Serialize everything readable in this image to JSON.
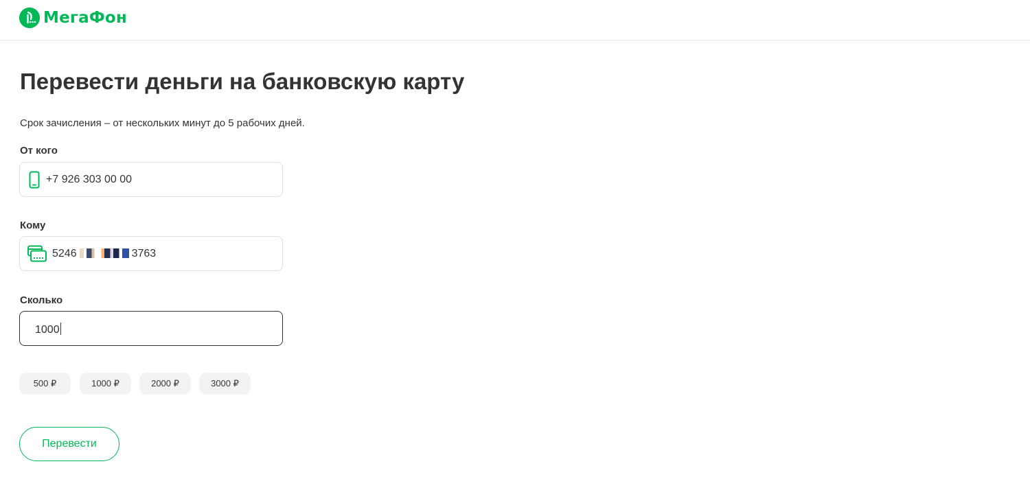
{
  "header": {
    "logo_text": "МегаФон"
  },
  "page": {
    "title": "Перевести деньги на банковскую карту",
    "subtitle": "Срок зачисления – от нескольких минут до 5 рабочих дней."
  },
  "from": {
    "label": "От кого",
    "value": "+7 926 303 00 00",
    "icon": "phone-icon"
  },
  "to": {
    "label": "Кому",
    "card_prefix": "5246",
    "card_suffix": "3763",
    "icon": "card-icon"
  },
  "amount": {
    "label": "Сколько",
    "value": "1000"
  },
  "quick_amounts": [
    "500 ₽",
    "1000 ₽",
    "2000 ₽",
    "3000 ₽"
  ],
  "submit_label": "Перевести",
  "colors": {
    "brand": "#00b956",
    "text": "#333333",
    "chip_bg": "#f2f3f5"
  }
}
